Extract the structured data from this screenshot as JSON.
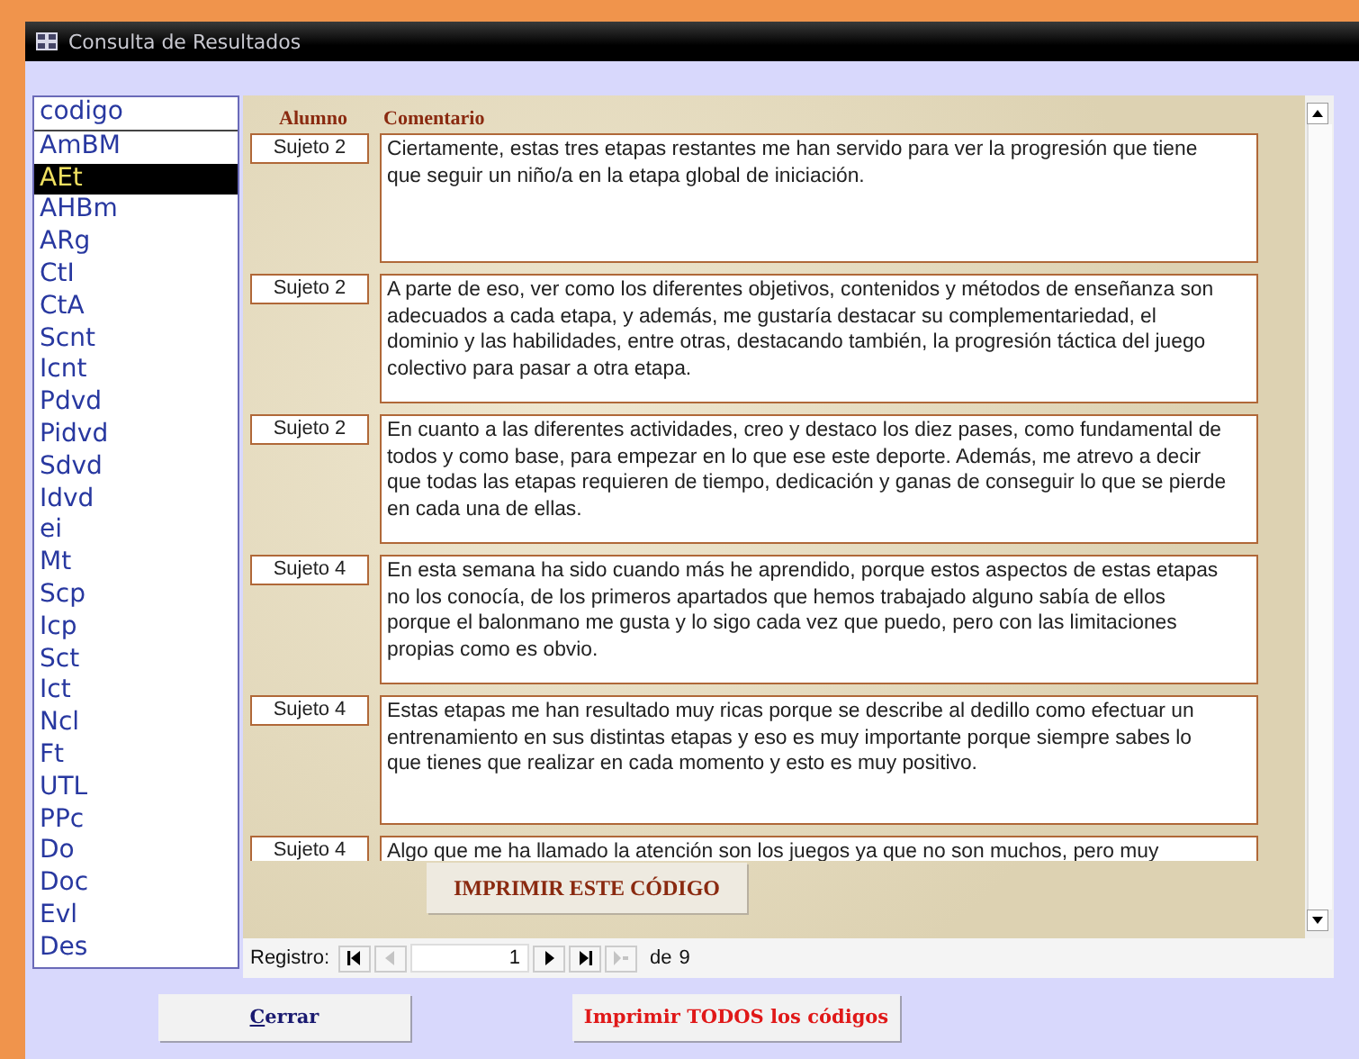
{
  "window": {
    "title": "Consulta de Resultados"
  },
  "codes": {
    "header": "codigo",
    "items": [
      {
        "label": "AmBM",
        "selected": false
      },
      {
        "label": "AEt",
        "selected": true
      },
      {
        "label": "AHBm",
        "selected": false
      },
      {
        "label": "ARg",
        "selected": false
      },
      {
        "label": "CtI",
        "selected": false
      },
      {
        "label": "CtA",
        "selected": false
      },
      {
        "label": "Scnt",
        "selected": false
      },
      {
        "label": "Icnt",
        "selected": false
      },
      {
        "label": "Pdvd",
        "selected": false
      },
      {
        "label": "Pidvd",
        "selected": false
      },
      {
        "label": "Sdvd",
        "selected": false
      },
      {
        "label": "Idvd",
        "selected": false
      },
      {
        "label": "ei",
        "selected": false
      },
      {
        "label": "Mt",
        "selected": false
      },
      {
        "label": "Scp",
        "selected": false
      },
      {
        "label": "Icp",
        "selected": false
      },
      {
        "label": "Sct",
        "selected": false
      },
      {
        "label": "Ict",
        "selected": false
      },
      {
        "label": "Ncl",
        "selected": false
      },
      {
        "label": "Ft",
        "selected": false
      },
      {
        "label": "UTL",
        "selected": false
      },
      {
        "label": "PPc",
        "selected": false
      },
      {
        "label": "Do",
        "selected": false
      },
      {
        "label": "Doc",
        "selected": false
      },
      {
        "label": "Evl",
        "selected": false
      },
      {
        "label": "Des",
        "selected": false
      }
    ]
  },
  "table": {
    "columns": [
      "Alumno",
      "Comentario"
    ],
    "rows": [
      {
        "alumno": "Sujeto 2",
        "comentario": "Ciertamente, estas tres etapas restantes me han servido para ver la progresión que tiene que seguir un niño/a en la etapa global de iniciación."
      },
      {
        "alumno": "Sujeto 2",
        "comentario": "A parte de eso, ver como los diferentes objetivos, contenidos y métodos de enseñanza son adecuados a cada etapa, y además, me gustaría destacar su complementariedad, el dominio y las habilidades, entre otras, destacando también, la progresión táctica del juego colectivo para pasar a otra etapa."
      },
      {
        "alumno": "Sujeto 2",
        "comentario": "En cuanto a las diferentes actividades, creo y destaco los diez pases, como fundamental de todos y como base, para empezar en lo que ese este deporte. Además, me atrevo a decir que todas las etapas requieren de tiempo, dedicación y ganas de conseguir lo que se pierde en cada una de ellas."
      },
      {
        "alumno": "Sujeto 4",
        "comentario": "En esta semana ha sido cuando más he aprendido, porque estos aspectos de estas etapas no los conocía, de los primeros apartados que hemos trabajado alguno sabía de ellos porque el balonmano me gusta y lo sigo cada vez que puedo, pero con las limitaciones propias como es obvio."
      },
      {
        "alumno": "Sujeto 4",
        "comentario": "Estas etapas me han resultado muy ricas porque se describe al dedillo como efectuar un entrenamiento en sus distintas etapas y eso es muy importante porque siempre sabes lo que tienes que realizar en cada momento y esto es muy positivo."
      },
      {
        "alumno": "Sujeto 4",
        "comentario": "Algo que me ha llamado la atención son los juegos ya que no son muchos, pero muy"
      }
    ]
  },
  "print_code_button": "IMPRIMIR ESTE CÓDIGO",
  "navigation": {
    "label": "Registro:",
    "record": "1",
    "of": "de",
    "total": "9",
    "buttons": [
      {
        "kind": "first",
        "disabled": false
      },
      {
        "kind": "prev",
        "disabled": true
      },
      {
        "kind": "next",
        "disabled": false
      },
      {
        "kind": "last",
        "disabled": false
      },
      {
        "kind": "new",
        "disabled": true
      }
    ]
  },
  "buttons": [
    {
      "kind": "close",
      "label": "Cerrar"
    },
    {
      "kind": "print_all",
      "label": "Imprimir TODOS los códigos"
    }
  ]
}
